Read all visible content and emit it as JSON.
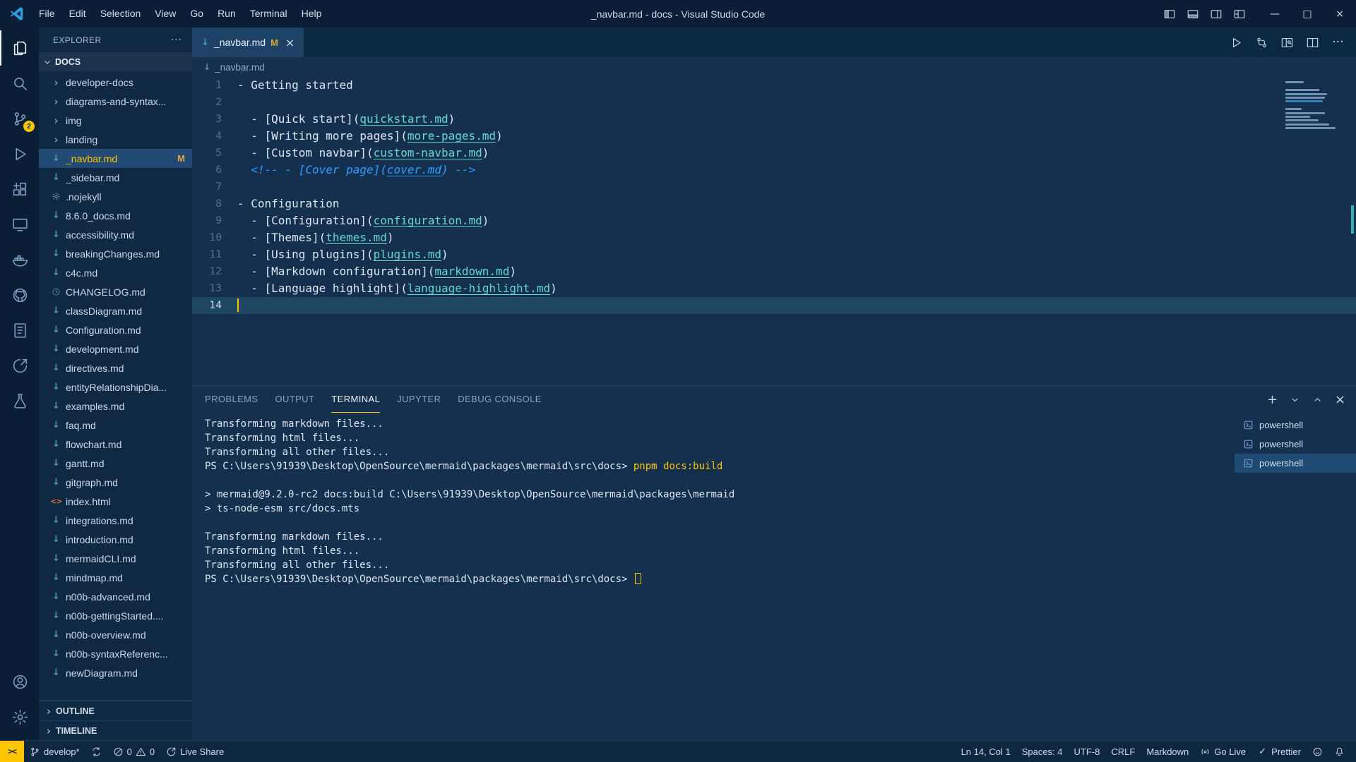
{
  "colors": {
    "accent": "#ffc600",
    "titlebar_bg": "#0a1f35",
    "activitybar_bg": "#0a1f35",
    "sidebar_bg": "#0f2942",
    "editor_bg": "#14304e",
    "tabbar_bg": "#0c2942",
    "tab_active_bg": "#1d4266",
    "line_highlight": "#1f4662",
    "statusbar_bg": "#0e2840",
    "text": "#dbe7f5",
    "dim_text": "#8aa6c4",
    "link_url": "#63d8d2",
    "comment": "#2f9dff",
    "modified": "#dfa73f",
    "md_icon": "#519aba",
    "html_icon": "#e37933"
  },
  "titlebar": {
    "menus": [
      "File",
      "Edit",
      "Selection",
      "View",
      "Go",
      "Run",
      "Terminal",
      "Help"
    ],
    "title": "_navbar.md - docs - Visual Studio Code",
    "layout_icons": [
      "layout-sidebar",
      "layout-panel",
      "layout-secondary-sidebar",
      "customize-layout"
    ],
    "window_buttons": [
      "minimize",
      "maximize",
      "close"
    ]
  },
  "activitybar": {
    "top": [
      {
        "name": "explorer",
        "active": true
      },
      {
        "name": "search"
      },
      {
        "name": "source-control",
        "badge": "2"
      },
      {
        "name": "run-debug"
      },
      {
        "name": "extensions"
      },
      {
        "name": "remote-explorer"
      },
      {
        "name": "docker"
      },
      {
        "name": "github"
      },
      {
        "name": "notebook"
      },
      {
        "name": "live-share"
      },
      {
        "name": "testing"
      }
    ],
    "bottom": [
      {
        "name": "account"
      },
      {
        "name": "settings"
      }
    ]
  },
  "sidebar": {
    "header": "EXPLORER",
    "section": "DOCS",
    "files": [
      {
        "name": "developer-docs",
        "kind": "folder"
      },
      {
        "name": "diagrams-and-syntax...",
        "kind": "folder"
      },
      {
        "name": "img",
        "kind": "folder"
      },
      {
        "name": "landing",
        "kind": "folder"
      },
      {
        "name": "_navbar.md",
        "kind": "md",
        "selected": true,
        "badge": "M"
      },
      {
        "name": "_sidebar.md",
        "kind": "md"
      },
      {
        "name": ".nojekyll",
        "kind": "config"
      },
      {
        "name": "8.6.0_docs.md",
        "kind": "md"
      },
      {
        "name": "accessibility.md",
        "kind": "md"
      },
      {
        "name": "breakingChanges.md",
        "kind": "md"
      },
      {
        "name": "c4c.md",
        "kind": "md"
      },
      {
        "name": "CHANGELOG.md",
        "kind": "changelog"
      },
      {
        "name": "classDiagram.md",
        "kind": "md"
      },
      {
        "name": "Configuration.md",
        "kind": "md"
      },
      {
        "name": "development.md",
        "kind": "md"
      },
      {
        "name": "directives.md",
        "kind": "md"
      },
      {
        "name": "entityRelationshipDia...",
        "kind": "md"
      },
      {
        "name": "examples.md",
        "kind": "md"
      },
      {
        "name": "faq.md",
        "kind": "md"
      },
      {
        "name": "flowchart.md",
        "kind": "md"
      },
      {
        "name": "gantt.md",
        "kind": "md"
      },
      {
        "name": "gitgraph.md",
        "kind": "md"
      },
      {
        "name": "index.html",
        "kind": "html"
      },
      {
        "name": "integrations.md",
        "kind": "md"
      },
      {
        "name": "introduction.md",
        "kind": "md"
      },
      {
        "name": "mermaidCLI.md",
        "kind": "md"
      },
      {
        "name": "mindmap.md",
        "kind": "md"
      },
      {
        "name": "n00b-advanced.md",
        "kind": "md"
      },
      {
        "name": "n00b-gettingStarted....",
        "kind": "md"
      },
      {
        "name": "n00b-overview.md",
        "kind": "md"
      },
      {
        "name": "n00b-syntaxReferenc...",
        "kind": "md"
      },
      {
        "name": "newDiagram.md",
        "kind": "md"
      }
    ],
    "bottom_sections": [
      "OUTLINE",
      "TIMELINE"
    ]
  },
  "editor": {
    "tab": {
      "label": "_navbar.md",
      "modified": "M"
    },
    "breadcrumb": "_navbar.md",
    "actions": [
      "run",
      "git-compare",
      "open-preview",
      "split-editor",
      "more-actions"
    ],
    "lines": [
      {
        "n": 1,
        "tokens": [
          {
            "t": "- Getting started",
            "c": "t"
          }
        ]
      },
      {
        "n": 2,
        "tokens": []
      },
      {
        "n": 3,
        "tokens": [
          {
            "t": "  - [Quick start](",
            "c": "t"
          },
          {
            "t": "quickstart.md",
            "c": "u"
          },
          {
            "t": ")",
            "c": "t"
          }
        ]
      },
      {
        "n": 4,
        "tokens": [
          {
            "t": "  - [Writing more pages](",
            "c": "t"
          },
          {
            "t": "more-pages.md",
            "c": "u"
          },
          {
            "t": ")",
            "c": "t"
          }
        ]
      },
      {
        "n": 5,
        "tokens": [
          {
            "t": "  - [Custom navbar](",
            "c": "t"
          },
          {
            "t": "custom-navbar.md",
            "c": "u"
          },
          {
            "t": ")",
            "c": "t"
          }
        ]
      },
      {
        "n": 6,
        "tokens": [
          {
            "t": "  <!-- - [Cover page](",
            "c": "c"
          },
          {
            "t": "cover.md",
            "c": "cu"
          },
          {
            "t": ") -->",
            "c": "c"
          }
        ]
      },
      {
        "n": 7,
        "tokens": []
      },
      {
        "n": 8,
        "tokens": [
          {
            "t": "- Configuration",
            "c": "t"
          }
        ]
      },
      {
        "n": 9,
        "tokens": [
          {
            "t": "  - [Configuration](",
            "c": "t"
          },
          {
            "t": "configuration.md",
            "c": "u"
          },
          {
            "t": ")",
            "c": "t"
          }
        ]
      },
      {
        "n": 10,
        "tokens": [
          {
            "t": "  - [Themes](",
            "c": "t"
          },
          {
            "t": "themes.md",
            "c": "u"
          },
          {
            "t": ")",
            "c": "t"
          }
        ]
      },
      {
        "n": 11,
        "tokens": [
          {
            "t": "  - [Using plugins](",
            "c": "t"
          },
          {
            "t": "plugins.md",
            "c": "u"
          },
          {
            "t": ")",
            "c": "t"
          }
        ]
      },
      {
        "n": 12,
        "tokens": [
          {
            "t": "  - [Markdown configuration](",
            "c": "t"
          },
          {
            "t": "markdown.md",
            "c": "u"
          },
          {
            "t": ")",
            "c": "t"
          }
        ]
      },
      {
        "n": 13,
        "tokens": [
          {
            "t": "  - [Language highlight](",
            "c": "t"
          },
          {
            "t": "language-highlight.md",
            "c": "u"
          },
          {
            "t": ")",
            "c": "t"
          }
        ]
      },
      {
        "n": 14,
        "current": true,
        "tokens": []
      }
    ]
  },
  "panel": {
    "tabs": [
      {
        "label": "PROBLEMS"
      },
      {
        "label": "OUTPUT"
      },
      {
        "label": "TERMINAL",
        "active": true
      },
      {
        "label": "JUPYTER"
      },
      {
        "label": "DEBUG CONSOLE"
      }
    ],
    "actions": [
      "new-terminal",
      "terminal-dropdown",
      "maximize-panel",
      "close-panel"
    ],
    "terminal_lines": [
      {
        "tokens": [
          {
            "t": "Transforming markdown files...",
            "c": "t"
          }
        ]
      },
      {
        "tokens": [
          {
            "t": "Transforming html files...",
            "c": "t"
          }
        ]
      },
      {
        "tokens": [
          {
            "t": "Transforming all other files...",
            "c": "t"
          }
        ]
      },
      {
        "tokens": [
          {
            "t": "PS C:\\Users\\91939\\Desktop\\OpenSource\\mermaid\\packages\\mermaid\\src\\docs> ",
            "c": "t"
          },
          {
            "t": "pnpm docs:build",
            "c": "y"
          }
        ]
      },
      {
        "tokens": []
      },
      {
        "tokens": [
          {
            "t": "> mermaid@9.2.0-rc2 docs:build C:\\Users\\91939\\Desktop\\OpenSource\\mermaid\\packages\\mermaid",
            "c": "t"
          }
        ]
      },
      {
        "tokens": [
          {
            "t": "> ts-node-esm src/docs.mts",
            "c": "t"
          }
        ]
      },
      {
        "tokens": []
      },
      {
        "tokens": [
          {
            "t": "Transforming markdown files...",
            "c": "t"
          }
        ]
      },
      {
        "tokens": [
          {
            "t": "Transforming html files...",
            "c": "t"
          }
        ]
      },
      {
        "tokens": [
          {
            "t": "Transforming all other files...",
            "c": "t"
          }
        ]
      },
      {
        "tokens": [
          {
            "t": "PS C:\\Users\\91939\\Desktop\\OpenSource\\mermaid\\packages\\mermaid\\src\\docs> ",
            "c": "t"
          }
        ],
        "cursor": true
      }
    ],
    "terminals": [
      {
        "label": "powershell"
      },
      {
        "label": "powershell"
      },
      {
        "label": "powershell",
        "selected": true
      }
    ]
  },
  "statusbar": {
    "remote": "><",
    "branch": "develop*",
    "errors": "0",
    "warnings": "0",
    "live_share": "Live Share",
    "cursor": "Ln 14, Col 1",
    "indent": "Spaces: 4",
    "encoding": "UTF-8",
    "eol": "CRLF",
    "language": "Markdown",
    "go_live": "Go Live",
    "formatter": "Prettier"
  }
}
